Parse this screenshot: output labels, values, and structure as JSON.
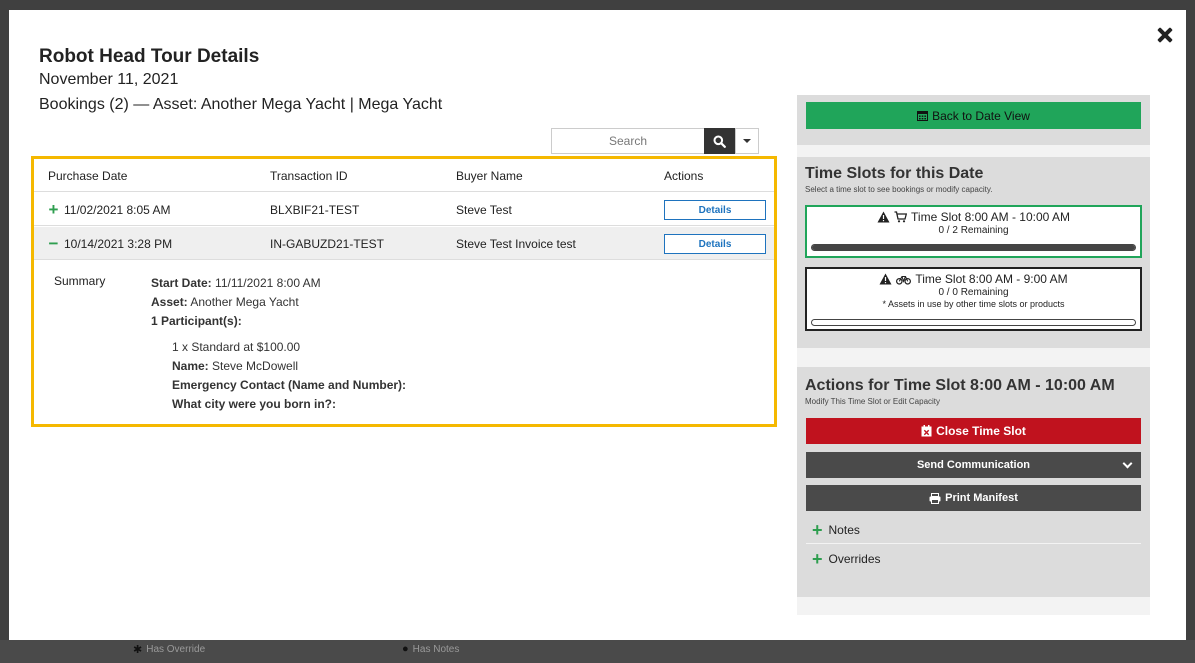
{
  "backdrop": {
    "legend_override": "Has Override",
    "legend_notes": "Has Notes"
  },
  "modal": {
    "title": "Robot Head Tour Details",
    "date": "November 11, 2021",
    "bookings_heading": "Bookings (2) — Asset: Another Mega Yacht | Mega Yacht",
    "search_placeholder": "Search"
  },
  "table": {
    "columns": [
      "Purchase Date",
      "Transaction ID",
      "Buyer Name",
      "Actions"
    ],
    "rows": [
      {
        "toggle": "+",
        "purchase_date": "11/02/2021 8:05 AM",
        "transaction_id": "BLXBIF21-TEST",
        "buyer_name": "Steve Test",
        "action": "Details"
      },
      {
        "toggle": "−",
        "purchase_date": "10/14/2021 3:28 PM",
        "transaction_id": "IN-GABUZD21-TEST",
        "buyer_name": "Steve Test Invoice test",
        "action": "Details"
      }
    ],
    "summary": {
      "label": "Summary",
      "start_date_label": "Start Date:",
      "start_date_value": "11/11/2021 8:00 AM",
      "asset_label": "Asset:",
      "asset_value": "Another Mega Yacht",
      "participants": "1 Participant(s):",
      "ticket": "1 x Standard at $100.00",
      "name_label": "Name:",
      "name_value": "Steve McDowell",
      "emergency": "Emergency Contact (Name and Number):",
      "city": "What city were you born in?:"
    }
  },
  "panel": {
    "back_label": "Back to Date View",
    "slots_title": "Time Slots for this Date",
    "slots_subtitle": "Select a time slot to see bookings or modify capacity.",
    "slots": [
      {
        "label": "Time Slot 8:00 AM - 10:00 AM",
        "remaining": "0 / 2 Remaining",
        "note": "",
        "icon": "cart-icon",
        "fill_fraction": 1.0
      },
      {
        "label": "Time Slot 8:00 AM - 9:00 AM",
        "remaining": "0 / 0 Remaining",
        "note": "* Assets in use by other time slots or products",
        "icon": "bicycle-icon",
        "fill_fraction": 0.0
      }
    ],
    "actions_title": "Actions for Time Slot 8:00 AM - 10:00 AM",
    "actions_subtitle": "Modify This Time Slot or Edit Capacity",
    "close_slot": "Close Time Slot",
    "send_communication": "Send Communication",
    "print_manifest": "Print Manifest",
    "notes": "Notes",
    "overrides": "Overrides"
  },
  "colors": {
    "accent_green": "#20a55a",
    "danger_red": "#c0121e",
    "highlight_yellow": "#f5b800",
    "link_blue": "#1e73be"
  }
}
